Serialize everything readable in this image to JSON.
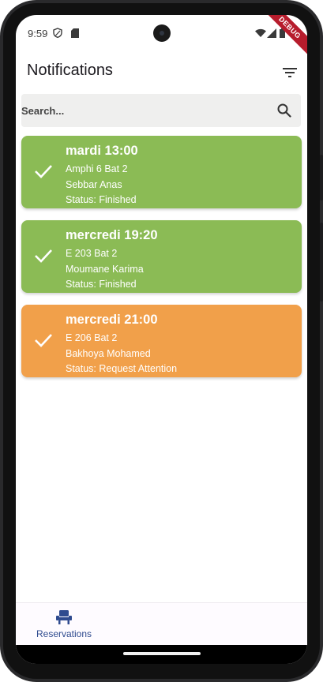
{
  "status_bar": {
    "time": "9:59"
  },
  "debug_banner": "DEBUG",
  "app_bar": {
    "title": "Notifications",
    "filter_icon": "filter-icon"
  },
  "search": {
    "placeholder": "Search...",
    "value": "",
    "icon": "search-icon"
  },
  "notifications": [
    {
      "title": "mardi 13:00",
      "room": "Amphi 6 Bat 2",
      "person": "Sebbar Anas",
      "status": "Status: Finished",
      "color": "#8bbb55",
      "icon": "check-icon"
    },
    {
      "title": "mercredi 19:20",
      "room": "E 203 Bat 2",
      "person": "Moumane Karima",
      "status": "Status: Finished",
      "color": "#8bbb55",
      "icon": "check-icon"
    },
    {
      "title": "mercredi 21:00",
      "room": "E 206 Bat 2",
      "person": "Bakhoya Mohamed",
      "status": "Status: Request Attention",
      "color": "#f1a04a",
      "icon": "check-icon"
    }
  ],
  "bottom_nav": {
    "items": [
      {
        "label": "Reservations",
        "icon": "seat-icon",
        "active": true
      }
    ]
  },
  "colors": {
    "finished": "#8bbb55",
    "attention": "#f1a04a",
    "nav_active": "#2f4b8f",
    "search_bg": "#efefee"
  }
}
